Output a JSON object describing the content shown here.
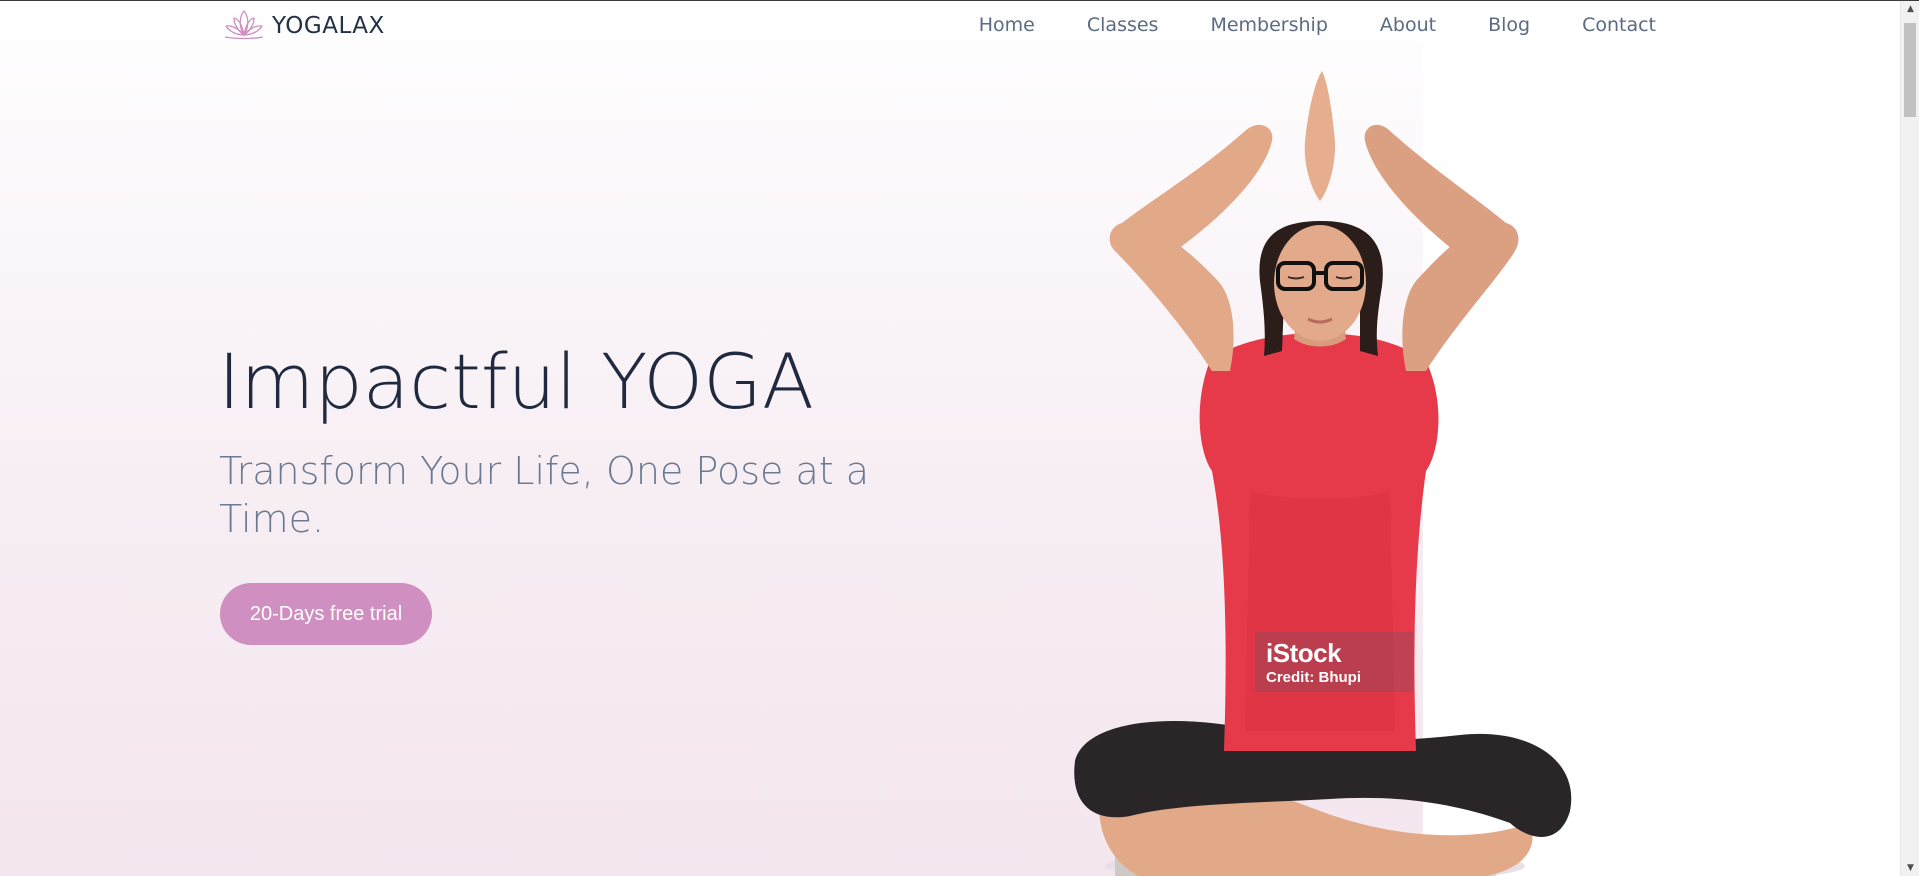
{
  "brand": {
    "name": "YOGALAX",
    "logo_icon": "lotus-icon"
  },
  "nav": {
    "items": [
      {
        "label": "Home"
      },
      {
        "label": "Classes"
      },
      {
        "label": "Membership"
      },
      {
        "label": "About"
      },
      {
        "label": "Blog"
      },
      {
        "label": "Contact"
      }
    ]
  },
  "hero": {
    "title": "Impactful YOGA",
    "subtitle": "Transform Your Life, One Pose at a Time.",
    "cta_label": "20-Days free trial",
    "image_alt": "woman-in-yoga-lotus-pose-photo"
  },
  "watermark": {
    "logo": "iStock",
    "credit": "Credit: Bhupi"
  },
  "colors": {
    "accent": "#cf8fc1",
    "heading": "#1f2a3f",
    "subtext": "#6b7a92",
    "nav_text": "#5b6b82"
  },
  "scrollbar": {
    "up_icon": "scroll-up-arrow-icon",
    "down_icon": "scroll-down-arrow-icon"
  }
}
